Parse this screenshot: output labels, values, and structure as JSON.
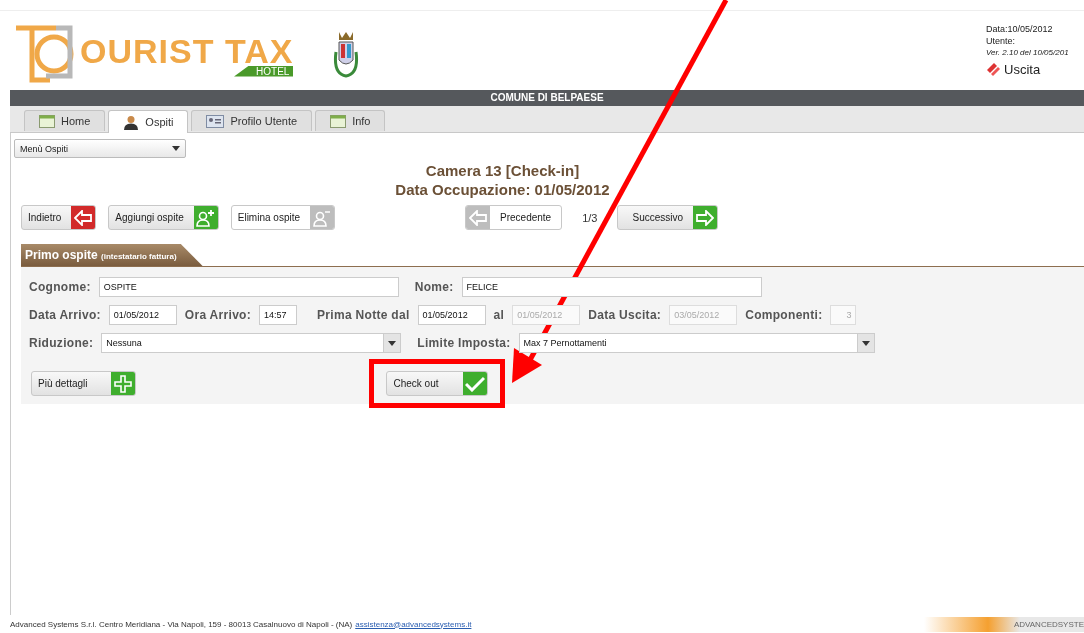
{
  "header": {
    "logo_text": "OURIST TAX",
    "logo_badge": "HOTEL",
    "info": {
      "date": "Data:10/05/2012",
      "user": "Utente:",
      "version": "Ver. 2.10 del 10/05/201"
    },
    "logout": "Uscita"
  },
  "banner": "COMUNE DI BELPAESE",
  "tabs": [
    {
      "label": "Home",
      "selected": false
    },
    {
      "label": "Ospiti",
      "selected": true
    },
    {
      "label": "Profilo Utente",
      "selected": false
    },
    {
      "label": "Info",
      "selected": false
    }
  ],
  "menu": {
    "value": "Menù Ospiti"
  },
  "title": [
    "Camera 13 [Check-in]",
    "Data Occupazione: 01/05/2012"
  ],
  "actions": [
    {
      "label": "Indietro",
      "kind": "back",
      "disabled": false
    },
    {
      "label": "Aggiungi ospite",
      "kind": "add-person",
      "disabled": false
    },
    {
      "label": "Elimina ospite",
      "kind": "remove-person",
      "disabled": true
    }
  ],
  "pager": {
    "previous": {
      "label": "Precedente",
      "disabled": true
    },
    "counter": "1/3",
    "next": {
      "label": "Successivo",
      "disabled": false
    }
  },
  "section": {
    "title": "Primo ospite",
    "subtitle": "(intestatario fattura)"
  },
  "form_rows": [
    [
      {
        "label": "Cognome:",
        "value": "OSPITE",
        "kind": "text",
        "disabled": false
      },
      {
        "label": "Nome:",
        "value": "FELICE",
        "kind": "text",
        "disabled": false
      }
    ],
    [
      {
        "label": "Data Arrivo:",
        "value": "01/05/2012",
        "kind": "date",
        "disabled": false
      },
      {
        "label": "Ora Arrivo:",
        "value": "14:57",
        "kind": "time",
        "disabled": false
      },
      {
        "label": "Prima Notte dal",
        "value": "01/05/2012",
        "kind": "date",
        "disabled": false
      },
      {
        "label": "al",
        "value": "01/05/2012",
        "kind": "date",
        "disabled": true
      },
      {
        "label": "Data Uscita:",
        "value": "03/05/2012",
        "kind": "date",
        "disabled": true
      },
      {
        "label": "Componenti:",
        "value": "3",
        "kind": "number",
        "disabled": true
      }
    ],
    [
      {
        "label": "Riduzione:",
        "value": "Nessuna",
        "kind": "select",
        "disabled": false
      },
      {
        "label": "Limite Imposta:",
        "value": "Max 7 Pernottamenti",
        "kind": "select",
        "disabled": false
      }
    ]
  ],
  "bottom_actions": [
    {
      "label": "Più dettagli",
      "kind": "plus",
      "highlighted": false
    },
    {
      "label": "Check out",
      "kind": "check",
      "highlighted": true
    }
  ],
  "footer": {
    "address": "Advanced Systems S.r.l. Centro Meridiana - Via Napoli, 159 - 80013 Casalnuovo di Napoli - (NA)",
    "email": "assistenza@advancedsystems.it",
    "brand": "ADVANCEDSYSTE"
  }
}
